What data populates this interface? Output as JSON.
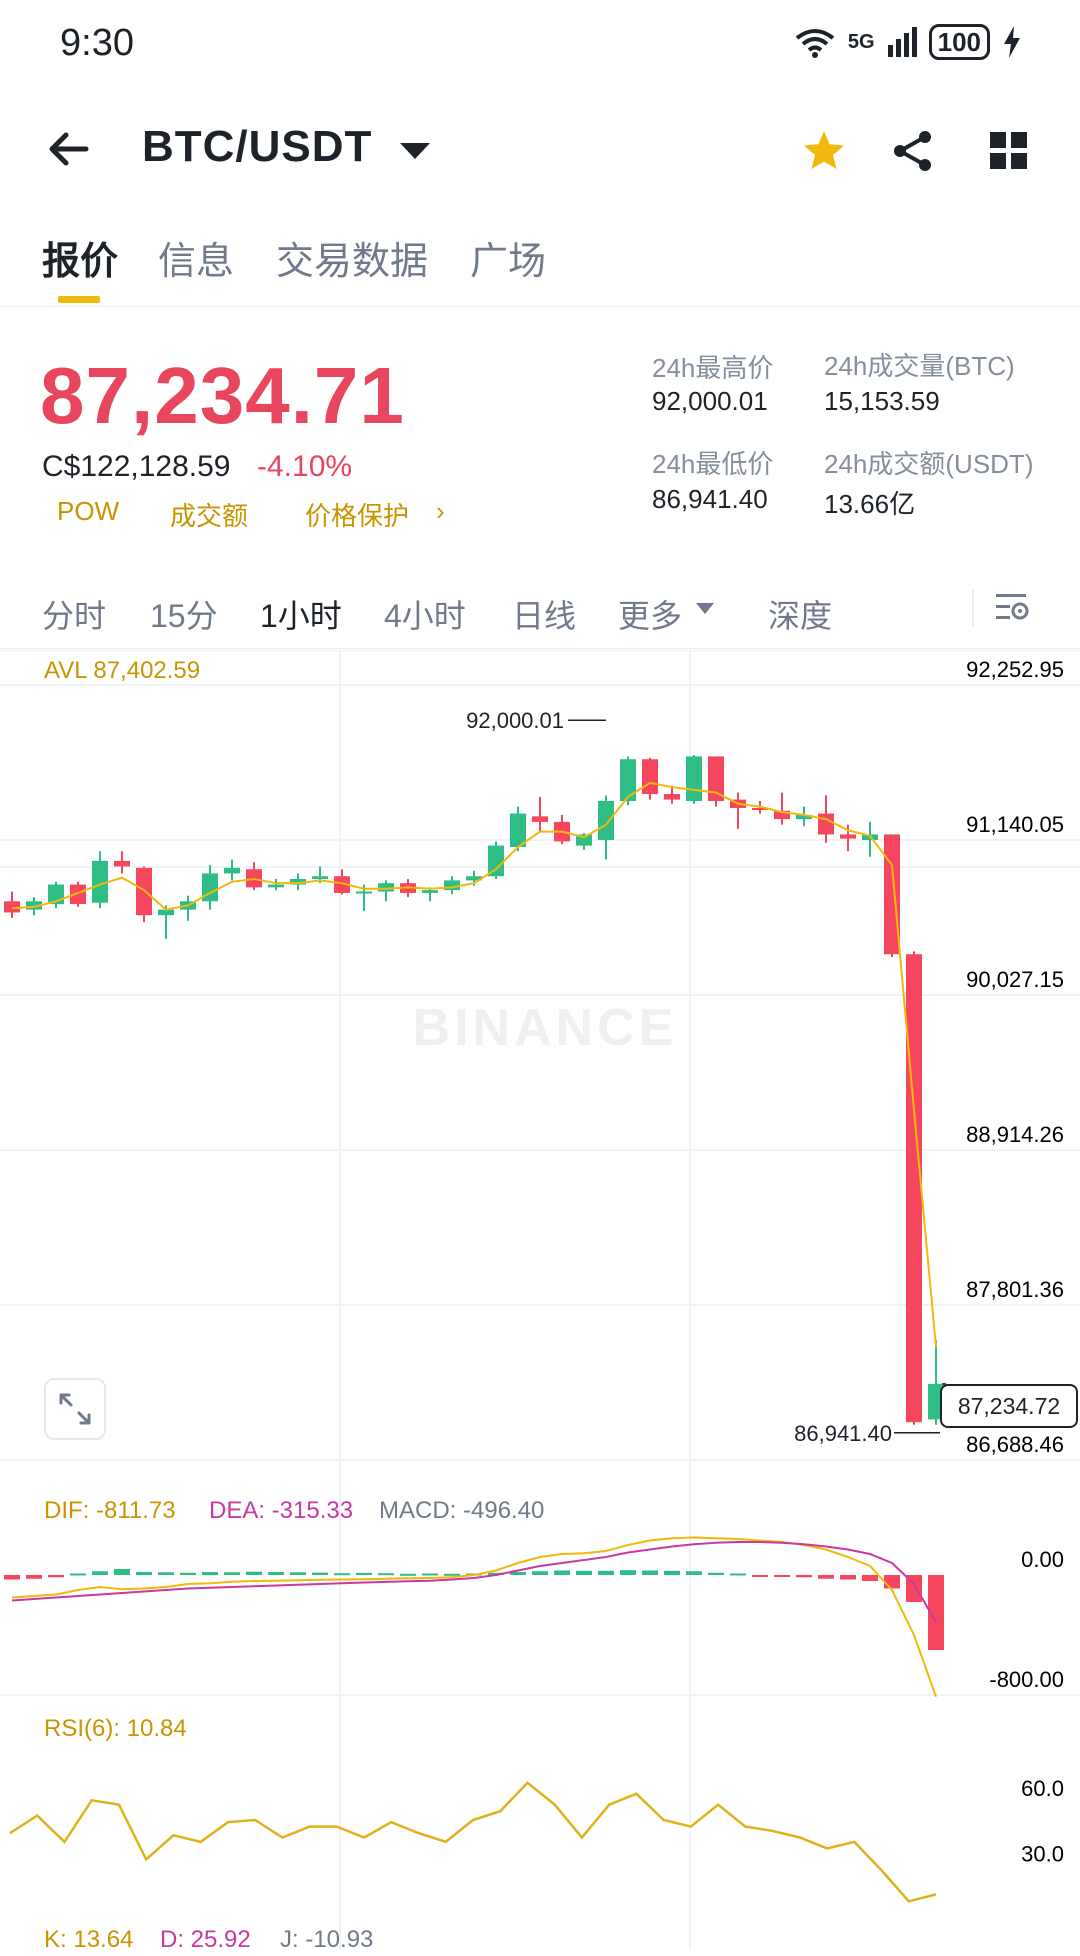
{
  "status_bar": {
    "time": "9:30",
    "network": "5G",
    "battery": "100"
  },
  "header": {
    "pair": "BTC/USDT",
    "icons": [
      "back-arrow-icon",
      "dropdown-caret-icon",
      "star-icon",
      "share-icon",
      "grid-icon"
    ],
    "star_color": "#f0b90b"
  },
  "tabs": [
    {
      "label": "报价",
      "active": true
    },
    {
      "label": "信息",
      "active": false
    },
    {
      "label": "交易数据",
      "active": false
    },
    {
      "label": "广场",
      "active": false
    }
  ],
  "price": {
    "last": "87,234.71",
    "fiat": "C$122,128.59",
    "change": "-4.10%",
    "tags": [
      "POW",
      "成交额",
      "价格保护"
    ],
    "arrow": "›"
  },
  "stats": {
    "high_label": "24h最高价",
    "high": "92,000.01",
    "low_label": "24h最低价",
    "low": "86,941.40",
    "vol_btc_label": "24h成交量(BTC)",
    "vol_btc": "15,153.59",
    "vol_usdt_label": "24h成交额(USDT)",
    "vol_usdt": "13.66亿"
  },
  "intervals": [
    {
      "label": "分时",
      "active": false
    },
    {
      "label": "15分",
      "active": false
    },
    {
      "label": "1小时",
      "active": true
    },
    {
      "label": "4小时",
      "active": false
    },
    {
      "label": "日线",
      "active": false
    },
    {
      "label": "更多",
      "active": false
    },
    {
      "label": "深度",
      "active": false
    }
  ],
  "colors": {
    "up": "#2ebd85",
    "down": "#f6465d",
    "accent": "#f0b90b",
    "avl": "#c99400",
    "dea": "#c93a9e"
  },
  "chart_data": {
    "type": "candlestick",
    "avl_label": "AVL 87,402.59",
    "watermark": "BINANCE",
    "y_ticks": [
      "92,252.95",
      "91,140.05",
      "90,027.15",
      "88,914.26",
      "87,801.36",
      "86,688.46"
    ],
    "ylim": [
      86688.46,
      92252.95
    ],
    "high_marker": "92,000.01",
    "low_marker": "86,941.40",
    "current_price_label": "87,234.72",
    "candles": [
      [
        90700,
        90770,
        90580,
        90620
      ],
      [
        90640,
        90730,
        90600,
        90700
      ],
      [
        90680,
        90840,
        90650,
        90820
      ],
      [
        90820,
        90840,
        90660,
        90680
      ],
      [
        90690,
        91060,
        90650,
        90990
      ],
      [
        90990,
        91060,
        90900,
        90950
      ],
      [
        90940,
        90950,
        90550,
        90600
      ],
      [
        90600,
        90670,
        90430,
        90640
      ],
      [
        90640,
        90740,
        90560,
        90700
      ],
      [
        90700,
        90960,
        90640,
        90900
      ],
      [
        90900,
        91000,
        90850,
        90940
      ],
      [
        90930,
        90980,
        90780,
        90800
      ],
      [
        90800,
        90860,
        90780,
        90820
      ],
      [
        90820,
        90900,
        90780,
        90860
      ],
      [
        90860,
        90950,
        90830,
        90880
      ],
      [
        90880,
        90930,
        90750,
        90760
      ],
      [
        90760,
        90820,
        90630,
        90770
      ],
      [
        90770,
        90850,
        90700,
        90830
      ],
      [
        90830,
        90860,
        90730,
        90760
      ],
      [
        90760,
        90800,
        90700,
        90780
      ],
      [
        90780,
        90880,
        90750,
        90850
      ],
      [
        90850,
        90920,
        90810,
        90880
      ],
      [
        90880,
        91130,
        90860,
        91100
      ],
      [
        91090,
        91380,
        91060,
        91330
      ],
      [
        91310,
        91450,
        91200,
        91270
      ],
      [
        91270,
        91320,
        91110,
        91130
      ],
      [
        91100,
        91190,
        91070,
        91180
      ],
      [
        91140,
        91460,
        91000,
        91420
      ],
      [
        91420,
        91740,
        91390,
        91720
      ],
      [
        91720,
        91730,
        91430,
        91470
      ],
      [
        91470,
        91530,
        91400,
        91430
      ],
      [
        91420,
        91750,
        91400,
        91740
      ],
      [
        91740,
        91740,
        91380,
        91420
      ],
      [
        91430,
        91480,
        91220,
        91370
      ],
      [
        91370,
        91420,
        91330,
        91360
      ],
      [
        91350,
        91480,
        91250,
        91290
      ],
      [
        91290,
        91380,
        91240,
        91320
      ],
      [
        91330,
        91460,
        91120,
        91180
      ],
      [
        91180,
        91250,
        91060,
        91150
      ],
      [
        91140,
        91270,
        91020,
        91180
      ],
      [
        91180,
        91180,
        90300,
        90320
      ],
      [
        90320,
        90340,
        86941.4,
        86960
      ],
      [
        86980,
        87550,
        86941.4,
        87234.72
      ]
    ],
    "ma": [
      90650,
      90660,
      90700,
      90760,
      90820,
      90870,
      90780,
      90640,
      90670,
      90760,
      90840,
      90860,
      90830,
      90830,
      90850,
      90830,
      90790,
      90790,
      90800,
      90790,
      90800,
      90830,
      90930,
      91090,
      91200,
      91200,
      91160,
      91250,
      91450,
      91550,
      91520,
      91500,
      91480,
      91400,
      91380,
      91340,
      91320,
      91290,
      91210,
      91170,
      90960,
      89200,
      87500
    ],
    "macd": {
      "label_dif": "DIF: -811.73",
      "label_dea": "DEA: -315.33",
      "label_macd": "MACD: -496.40",
      "y_ticks": [
        "0.00",
        "-800.00"
      ],
      "ylim": [
        -800,
        300
      ],
      "hist": [
        -30,
        -25,
        -15,
        10,
        25,
        40,
        20,
        18,
        15,
        20,
        18,
        22,
        20,
        18,
        16,
        12,
        14,
        12,
        8,
        10,
        8,
        10,
        15,
        20,
        25,
        30,
        28,
        28,
        32,
        30,
        28,
        25,
        15,
        10,
        -5,
        -10,
        -15,
        -25,
        -30,
        -40,
        -90,
        -180,
        -500
      ],
      "dif": [
        -150,
        -140,
        -130,
        -100,
        -80,
        -95,
        -90,
        -80,
        -60,
        -55,
        -45,
        -40,
        -38,
        -35,
        -32,
        -30,
        -28,
        -25,
        -22,
        -20,
        -15,
        0,
        30,
        80,
        120,
        140,
        145,
        160,
        200,
        230,
        245,
        250,
        245,
        240,
        230,
        220,
        200,
        170,
        120,
        60,
        -100,
        -400,
        -811.73
      ],
      "dea": [
        -170,
        -160,
        -150,
        -140,
        -130,
        -120,
        -110,
        -100,
        -90,
        -85,
        -80,
        -75,
        -70,
        -65,
        -60,
        -55,
        -50,
        -46,
        -42,
        -38,
        -30,
        -20,
        0,
        30,
        60,
        80,
        100,
        120,
        150,
        170,
        190,
        205,
        215,
        220,
        220,
        215,
        205,
        190,
        170,
        140,
        80,
        -60,
        -315.33
      ]
    },
    "rsi": {
      "label": "RSI(6): 10.84",
      "y_ticks": [
        "60.0",
        "30.0"
      ],
      "ylim": [
        0,
        80
      ],
      "values": [
        42,
        50,
        38,
        57,
        55,
        30,
        41,
        38,
        47,
        48,
        40,
        45,
        45,
        40,
        47,
        42,
        38,
        48,
        52,
        65,
        55,
        40,
        55,
        60,
        48,
        45,
        55,
        45,
        43,
        40,
        35,
        38,
        25,
        10.84,
        14
      ]
    },
    "kdj": {
      "k": "K: 13.64",
      "d": "D: 25.92",
      "j": "J: -10.93"
    }
  }
}
